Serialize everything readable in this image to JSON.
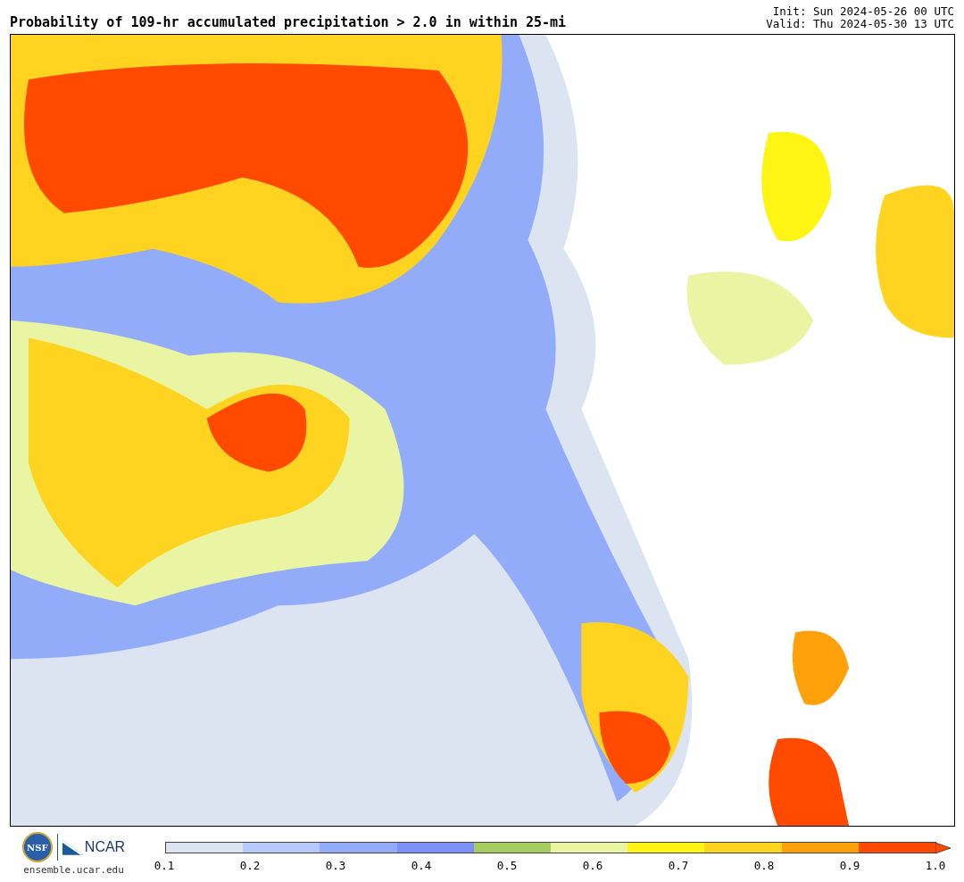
{
  "title": "Probability of 109-hr accumulated precipitation > 2.0 in within 25-mi",
  "init": "Init: Sun 2024-05-26 00 UTC",
  "valid": "Valid: Thu 2024-05-30 13 UTC",
  "logos": {
    "nsf": "NSF",
    "ncar": "NCAR",
    "site": "ensemble.ucar.edu"
  },
  "colorbar": {
    "segments": [
      {
        "color": "#dbe4f0"
      },
      {
        "color": "#b5c9fa"
      },
      {
        "color": "#92acfa"
      },
      {
        "color": "#7b91f7"
      },
      {
        "color": "#a5cc5f"
      },
      {
        "color": "#e9f5a3"
      },
      {
        "color": "#fff514"
      },
      {
        "color": "#ffd420"
      },
      {
        "color": "#ffa10a"
      },
      {
        "color": "#ff4a00"
      }
    ],
    "ticks": [
      "0.1",
      "0.2",
      "0.3",
      "0.4",
      "0.5",
      "0.6",
      "0.7",
      "0.8",
      "0.9",
      "1.0"
    ]
  }
}
